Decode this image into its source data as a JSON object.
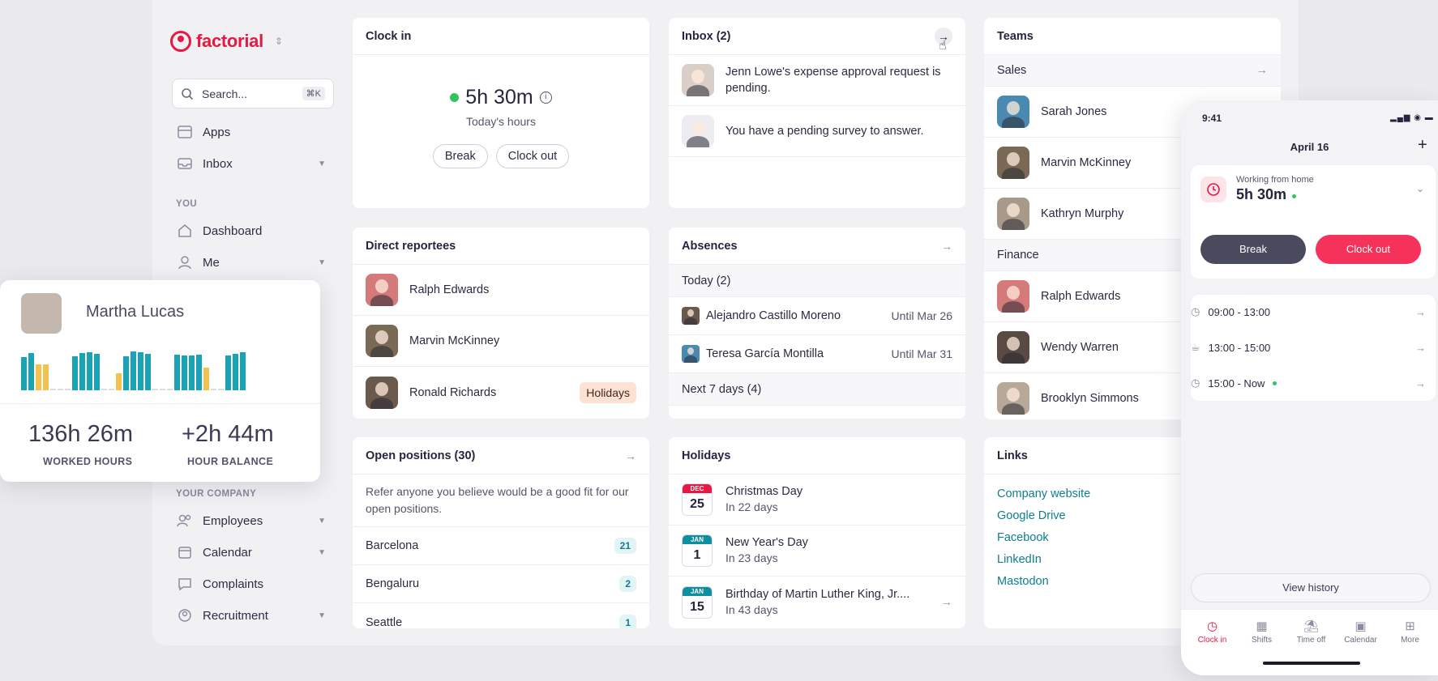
{
  "brand": {
    "name": "factorial"
  },
  "search": {
    "placeholder": "Search...",
    "shortcut": "⌘K"
  },
  "sidebar": {
    "items": [
      {
        "label": "Apps"
      },
      {
        "label": "Inbox"
      },
      {
        "label": "Dashboard"
      },
      {
        "label": "Me"
      },
      {
        "label": "Employees"
      },
      {
        "label": "Calendar"
      },
      {
        "label": "Complaints"
      },
      {
        "label": "Recruitment"
      }
    ],
    "section_you": "YOU",
    "section_company": "YOUR COMPANY"
  },
  "clockin": {
    "title": "Clock in",
    "time": "5h 30m",
    "subtitle": "Today's hours",
    "break_label": "Break",
    "clockout_label": "Clock out"
  },
  "inbox": {
    "title": "Inbox (2)",
    "items": [
      {
        "text": "Jenn Lowe's expense approval request is pending."
      },
      {
        "text": "You have a pending survey to answer."
      }
    ]
  },
  "teams": {
    "title": "Teams",
    "groups": [
      {
        "name": "Sales",
        "members": [
          "Sarah Jones",
          "Marvin McKinney",
          "Kathryn Murphy"
        ]
      },
      {
        "name": "Finance",
        "members": [
          "Ralph Edwards",
          "Wendy Warren",
          "Brooklyn Simmons"
        ]
      }
    ]
  },
  "reportees": {
    "title": "Direct reportees",
    "items": [
      {
        "name": "Ralph Edwards"
      },
      {
        "name": "Marvin McKinney"
      },
      {
        "name": "Ronald Richards",
        "badge": "Holidays"
      }
    ]
  },
  "absences": {
    "title": "Absences",
    "today_label": "Today (2)",
    "items": [
      {
        "name": "Alejandro Castillo Moreno",
        "until": "Until Mar 26"
      },
      {
        "name": "Teresa García Montilla",
        "until": "Until Mar 31"
      }
    ],
    "next_label": "Next 7 days (4)"
  },
  "positions": {
    "title": "Open positions (30)",
    "description": "Refer anyone you believe would be a good fit for our open positions.",
    "items": [
      {
        "city": "Barcelona",
        "count": "21"
      },
      {
        "city": "Bengaluru",
        "count": "2"
      },
      {
        "city": "Seattle",
        "count": "1"
      }
    ]
  },
  "holidays": {
    "title": "Holidays",
    "items": [
      {
        "month": "DEC",
        "day": "25",
        "name": "Christmas Day",
        "when": "In 22 days",
        "color": "#e51943"
      },
      {
        "month": "JAN",
        "day": "1",
        "name": "New Year's Day",
        "when": "In 23 days",
        "color": "#0e8f9e"
      },
      {
        "month": "JAN",
        "day": "15",
        "name": "Birthday of Martin Luther King, Jr....",
        "when": "In 43 days",
        "color": "#0e8f9e"
      }
    ]
  },
  "links": {
    "title": "Links",
    "items": [
      "Company website",
      "Google Drive",
      "Facebook",
      "LinkedIn",
      "Mastodon"
    ]
  },
  "martha": {
    "name": "Martha Lucas",
    "worked_value": "136h 26m",
    "worked_label": "WORKED HOURS",
    "balance_value": "+2h 44m",
    "balance_label": "HOUR BALANCE",
    "bar_levels": [
      0.78,
      0.88,
      0.62,
      0.62,
      0,
      0,
      0,
      0.8,
      0.88,
      0.9,
      0.86,
      0,
      0,
      0.4,
      0.8,
      0.92,
      0.9,
      0.86,
      0,
      0,
      0,
      0.84,
      0.82,
      0.82,
      0.84,
      0.54,
      0,
      0,
      0.82,
      0.86,
      0.9
    ]
  },
  "phone": {
    "status_time": "9:41",
    "date": "April 16",
    "status_label": "Working from home",
    "time": "5h 30m",
    "break_label": "Break",
    "clockout_label": "Clock out",
    "entries": [
      {
        "range": "09:00 - 13:00",
        "icon": "clock-icon"
      },
      {
        "range": "13:00 - 15:00",
        "icon": "coffee-icon"
      },
      {
        "range": "15:00 - Now",
        "icon": "clock-icon"
      }
    ],
    "history_label": "View history",
    "tabs": [
      "Clock in",
      "Shifts",
      "Time off",
      "Calendar",
      "More"
    ]
  },
  "colors": {
    "brand": "#e51943",
    "teal": "#0e8f9e",
    "bar_teal": "#1aa3b5",
    "bar_yellow": "#f2c14e",
    "green": "#2fc45c"
  }
}
